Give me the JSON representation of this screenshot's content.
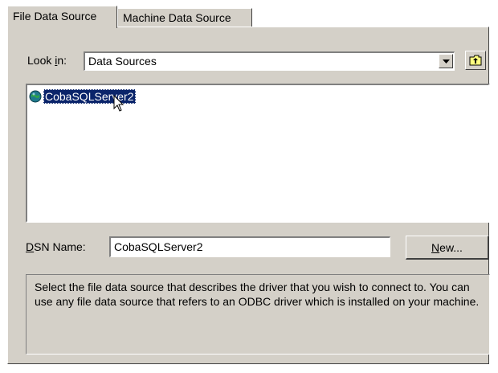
{
  "tabs": [
    {
      "label": "File Data Source",
      "active": true
    },
    {
      "label": "Machine Data Source",
      "active": false
    }
  ],
  "look_in": {
    "label_pre": "Look ",
    "label_hotkey": "i",
    "label_post": "n:",
    "value": "Data Sources"
  },
  "file_list": {
    "items": [
      {
        "label": "CobaSQLServer2",
        "icon": "globe-icon",
        "selected": true
      }
    ]
  },
  "dsn": {
    "label_hotkey": "D",
    "label_post": "SN Name:",
    "value": "CobaSQLServer2"
  },
  "new_button": {
    "hotkey": "N",
    "rest": "ew..."
  },
  "description": "Select the file data source that describes the driver that you wish to connect to. You can use any file data source that refers to an ODBC driver which is installed on your machine.",
  "colors": {
    "dialog_bg": "#d4d0c8",
    "selection_bg": "#0a246a",
    "selection_text": "#ffffff"
  }
}
